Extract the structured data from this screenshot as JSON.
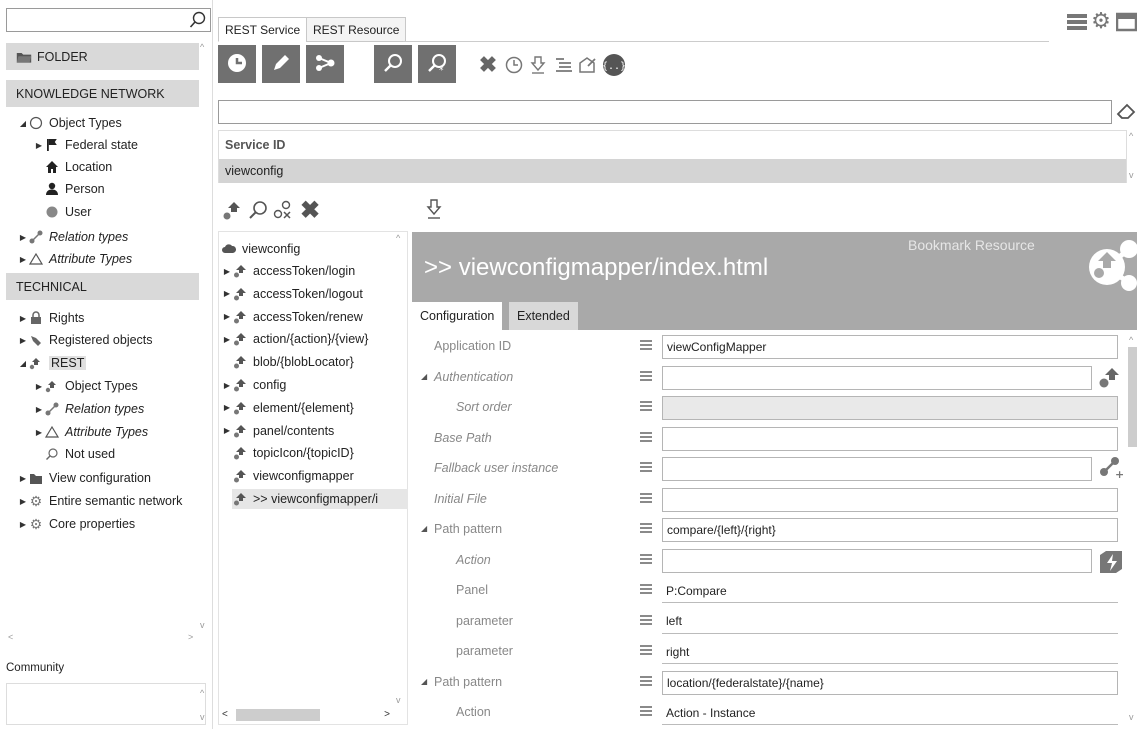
{
  "left": {
    "search_placeholder": "",
    "sections": {
      "folder": "FOLDER",
      "knowledge_network": "KNOWLEDGE NETWORK",
      "technical": "TECHNICAL"
    },
    "knowledge_items": [
      {
        "label": "Object Types",
        "icon": "circle-outline-icon"
      },
      {
        "label": "Federal state",
        "icon": "flag-icon"
      },
      {
        "label": "Location",
        "icon": "home-icon"
      },
      {
        "label": "Person",
        "icon": "person-icon"
      },
      {
        "label": "User",
        "icon": "circle-filled-icon"
      },
      {
        "label": "Relation types",
        "icon": "relation-icon"
      },
      {
        "label": "Attribute Types",
        "icon": "triangle-icon"
      }
    ],
    "technical_items": [
      {
        "label": "Rights",
        "icon": "lock-icon"
      },
      {
        "label": "Registered objects",
        "icon": "registered-icon"
      },
      {
        "label": "REST",
        "icon": "rest-icon"
      },
      {
        "label": "Object Types",
        "icon": "rest-icon"
      },
      {
        "label": "Relation types",
        "icon": "relation-icon"
      },
      {
        "label": "Attribute Types",
        "icon": "triangle-icon"
      },
      {
        "label": "Not used",
        "icon": "search-icon"
      },
      {
        "label": "View configuration",
        "icon": "folder-icon"
      },
      {
        "label": "Entire semantic network",
        "icon": "gear-icon"
      },
      {
        "label": "Core properties",
        "icon": "gear-icon"
      }
    ],
    "community_label": "Community"
  },
  "tabs": [
    "REST Service",
    "REST Resource"
  ],
  "service": {
    "header": "Service ID",
    "value": "viewconfig"
  },
  "middle": {
    "root": "viewconfig",
    "items": [
      "accessToken/login",
      "accessToken/logout",
      "accessToken/renew",
      "action/{action}/{view}",
      "blob/{blobLocator}",
      "config",
      "element/{element}",
      "panel/contents",
      "topicIcon/{topicID}",
      "viewconfigmapper",
      ">> viewconfigmapper/i"
    ]
  },
  "detail": {
    "title": ">> viewconfigmapper/index.html",
    "subtitle": "Bookmark Resource",
    "tabs": [
      "Configuration",
      "Extended"
    ],
    "accent": "#a9a9a9"
  },
  "form": [
    {
      "label": "Application ID",
      "value": "viewConfigMapper"
    },
    {
      "label": "Authentication",
      "value": ""
    },
    {
      "label": "Sort order",
      "value": ""
    },
    {
      "label": "Base Path",
      "value": ""
    },
    {
      "label": "Fallback user instance",
      "value": ""
    },
    {
      "label": "Initial File",
      "value": ""
    },
    {
      "label": "Path pattern",
      "value": "compare/{left}/{right}"
    },
    {
      "label": "Action",
      "value": ""
    },
    {
      "label": "Panel",
      "value": "P:Compare"
    },
    {
      "label": "parameter",
      "value": "left"
    },
    {
      "label": "parameter",
      "value": "right"
    },
    {
      "label": "Path pattern",
      "value": "location/{federalstate}/{name}"
    },
    {
      "label": "Action",
      "value": "Action - Instance"
    }
  ]
}
